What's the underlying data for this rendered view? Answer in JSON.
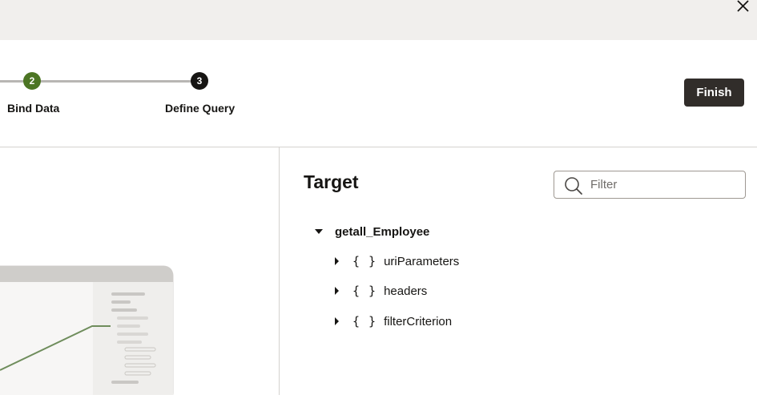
{
  "dialog": {
    "close_icon": "close-icon"
  },
  "train": {
    "steps": [
      {
        "number": "2",
        "label": "Bind Data",
        "state": "visited",
        "color": "#4c7524"
      },
      {
        "number": "3",
        "label": "Define Query",
        "state": "current",
        "color": "#161513"
      }
    ]
  },
  "actions": {
    "finish_label": "Finish"
  },
  "target": {
    "title": "Target",
    "filter_placeholder": "Filter",
    "root": {
      "label": "getall_Employee",
      "expanded": true
    },
    "children": [
      {
        "icon": "{ }",
        "label": "uriParameters",
        "expanded": false
      },
      {
        "icon": "{ }",
        "label": "headers",
        "expanded": false
      },
      {
        "icon": "{ }",
        "label": "filterCriterion",
        "expanded": false
      }
    ]
  },
  "colors": {
    "accent_green": "#4c7524",
    "connector_green": "#6f8d5c",
    "primary_button": "#312d2a",
    "header_bg": "#f1efed"
  }
}
